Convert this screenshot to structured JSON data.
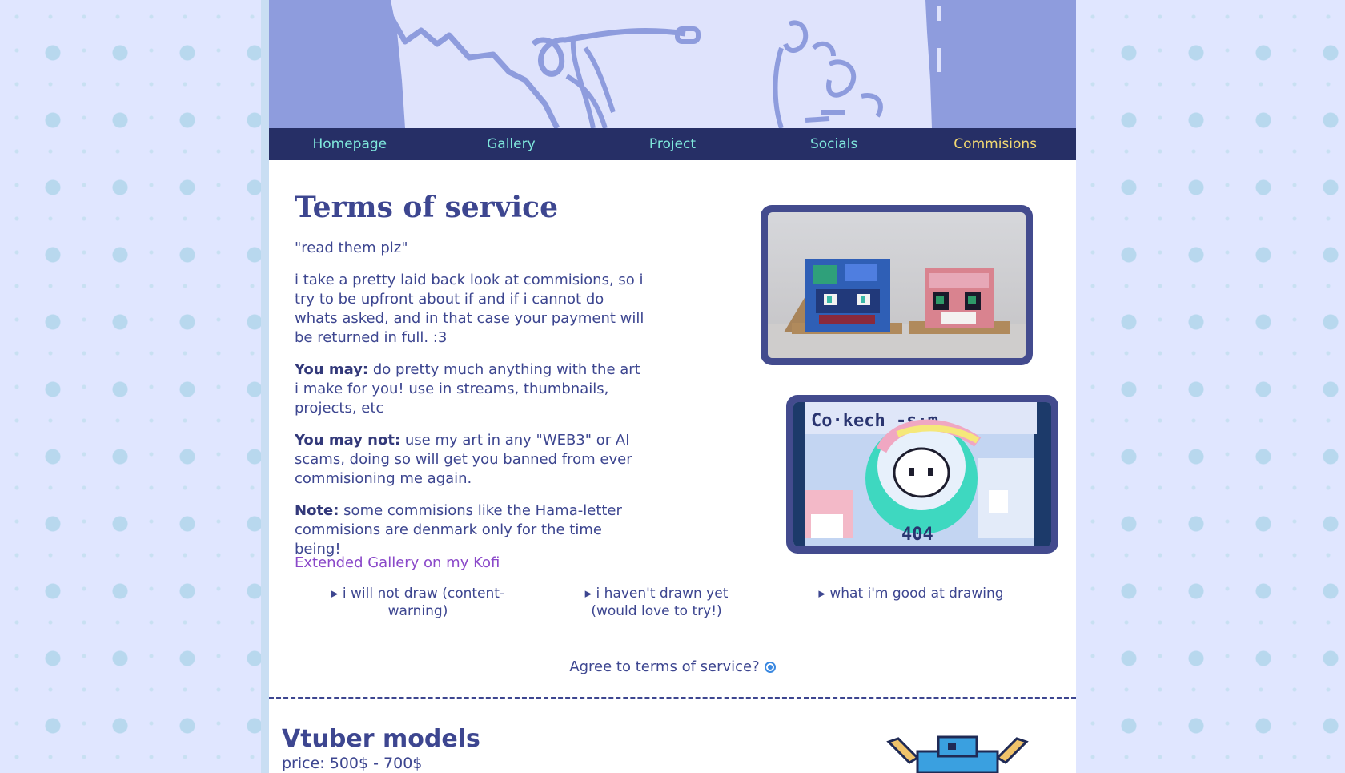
{
  "nav": {
    "items": [
      {
        "label": "Homepage"
      },
      {
        "label": "Gallery"
      },
      {
        "label": "Project"
      },
      {
        "label": "Socials"
      },
      {
        "label": "Commisions"
      }
    ],
    "active_color": "#f2d872",
    "link_color": "#7fe8dc"
  },
  "tos": {
    "title": "Terms of service",
    "quote": "\"read them plz\"",
    "intro": "i take a pretty laid back look at commisions, so i try to be upfront about if and if i cannot do whats asked, and in that case your payment will be returned in full. :3",
    "may_label": "You may:",
    "may_text": " do pretty much anything with the art i make for you! use in streams, thumbnails, projects, etc",
    "maynot_label": "You may not:",
    "maynot_text": " use my art in any \"WEB3\" or AI scams, doing so will get you banned from ever commisioning me again.",
    "note_label": "Note:",
    "note_text": " some commisions like the Hama-letter commisions are denmark only for the time being!",
    "kofi_link": "Extended Gallery on my Kofi"
  },
  "details": [
    {
      "label": "▸ i will not draw (content-warning)"
    },
    {
      "label": "▸ i haven't drawn yet (would love to try!)"
    },
    {
      "label": "▸ what i'm good at drawing"
    }
  ],
  "agree": {
    "label": "Agree to terms of service?"
  },
  "vtuber": {
    "title": "Vtuber models",
    "price": "price: 500$ - 700$"
  },
  "colors": {
    "banner_bg": "#dfe3fc",
    "banner_art": "#8e9cdd",
    "nav_bg": "#262f66",
    "text": "#3d4690",
    "link": "#8a48c9",
    "photo_border": "#434b8e"
  },
  "icons": {
    "radio": "radio-selected-icon"
  }
}
